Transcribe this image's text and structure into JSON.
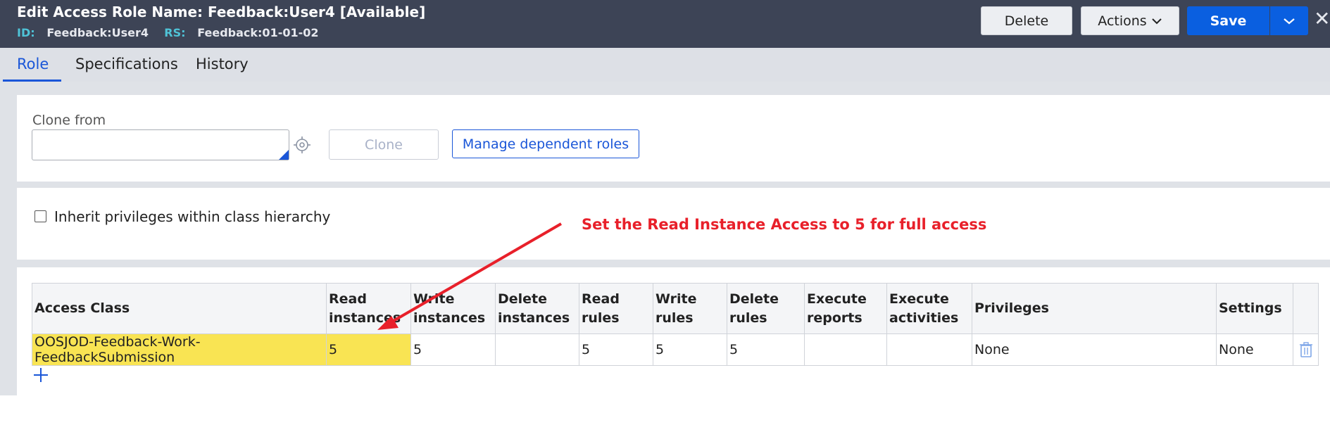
{
  "header": {
    "title": "Edit  Access Role Name: Feedback:User4 [Available]",
    "id_key": "ID:",
    "id_value": "Feedback:User4",
    "rs_key": "RS:",
    "rs_value": "Feedback:01-01-02",
    "delete_label": "Delete",
    "actions_label": "Actions",
    "save_label": "Save",
    "close_glyph": "✕"
  },
  "tabs": [
    {
      "label": "Role",
      "active": true
    },
    {
      "label": "Specifications",
      "active": false
    },
    {
      "label": "History",
      "active": false
    }
  ],
  "clone": {
    "label": "Clone from",
    "value": "",
    "clone_button": "Clone",
    "manage_button": "Manage dependent roles"
  },
  "inherit": {
    "label": "Inherit privileges within class hierarchy",
    "checked": false
  },
  "annotation": {
    "text": "Set the Read Instance Access to 5 for full access",
    "color": "#e8202a"
  },
  "table": {
    "headers": [
      [
        "Access Class"
      ],
      [
        "Read",
        "instances"
      ],
      [
        "Write",
        "instances"
      ],
      [
        "Delete",
        "instances"
      ],
      [
        "Read",
        "rules"
      ],
      [
        "Write",
        "rules"
      ],
      [
        "Delete",
        "rules"
      ],
      [
        "Execute",
        "reports"
      ],
      [
        "Execute",
        "activities"
      ],
      [
        "Privileges"
      ],
      [
        "Settings"
      ],
      [
        ""
      ]
    ],
    "row": [
      "OOSJOD-Feedback-Work-FeedbackSubmission",
      "5",
      "5",
      "",
      "5",
      "5",
      "5",
      "",
      "",
      "None",
      "None"
    ]
  },
  "icons": {
    "target": "target-icon",
    "trash": "trash-icon",
    "add": "plus-icon",
    "chevron": "chevron-down-icon"
  },
  "colors": {
    "header_bg": "#3d4456",
    "accent": "#1a56d8",
    "save": "#0a5fe0",
    "highlight": "#f9e453"
  }
}
